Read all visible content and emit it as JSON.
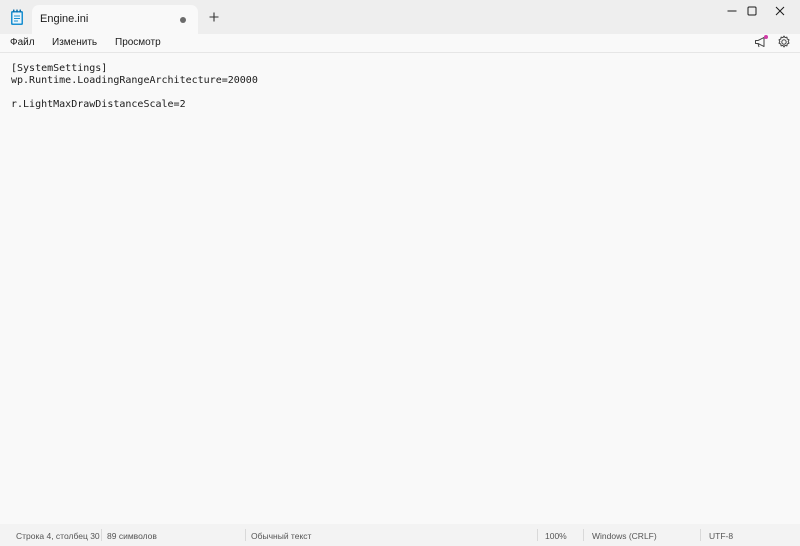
{
  "tab": {
    "title": "Engine.ini"
  },
  "menu": {
    "file": "Файл",
    "edit": "Изменить",
    "view": "Просмотр"
  },
  "editor": {
    "lines": [
      "[SystemSettings]",
      "wp.Runtime.LoadingRangeArchitecture=20000",
      "",
      "r.LightMaxDrawDistanceScale=2"
    ]
  },
  "status": {
    "position": "Строка 4, столбец 30",
    "chars": "89 символов",
    "format": "Обычный текст",
    "zoom": "100%",
    "line_ending": "Windows (CRLF)",
    "encoding": "UTF-8"
  },
  "icons": {
    "app": "notepad-icon",
    "new_tab": "plus-icon",
    "unsaved": "unsaved-dot-icon",
    "minimize": "minimize-icon",
    "maximize": "maximize-icon",
    "close": "close-icon",
    "feedback": "megaphone-icon",
    "settings": "gear-icon"
  },
  "colors": {
    "titlebar": "#eeeeee",
    "editor_bg": "#f9f9f9",
    "statusbar": "#f3f3f3",
    "notification": "#d13ba8"
  }
}
